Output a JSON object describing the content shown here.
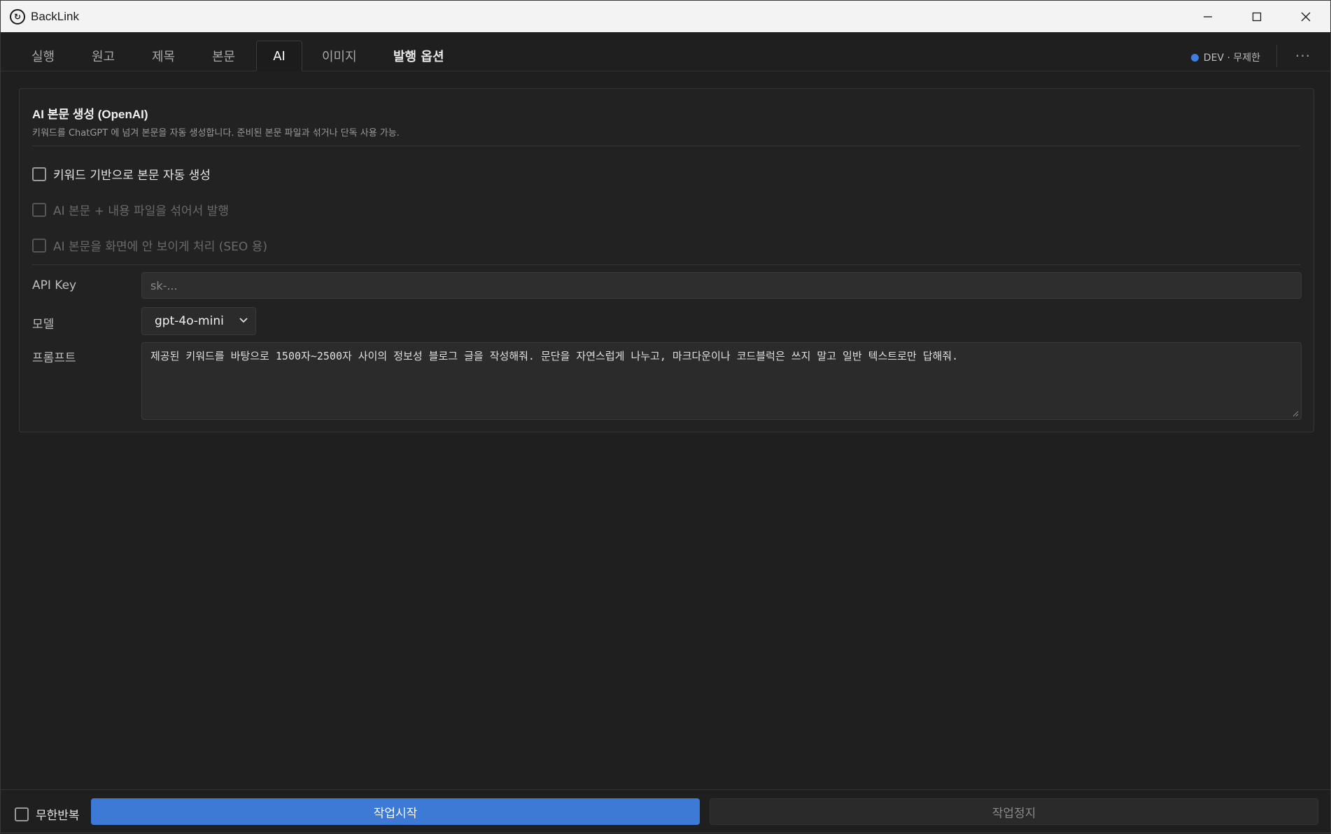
{
  "window": {
    "title": "BackLink",
    "minimize_icon": "minimize-icon",
    "maximize_icon": "maximize-icon",
    "close_icon": "close-icon"
  },
  "tabs": [
    {
      "label": "실행"
    },
    {
      "label": "원고"
    },
    {
      "label": "제목"
    },
    {
      "label": "본문"
    },
    {
      "label": "AI"
    },
    {
      "label": "이미지"
    },
    {
      "label": "발행 옵션"
    }
  ],
  "active_tab": "AI",
  "status": {
    "label": "DEV · 무제한",
    "dot_color": "#3d7ee0"
  },
  "more_label": "···",
  "panel": {
    "title": "AI 본문 생성 (OpenAI)",
    "description": "키워드를 ChatGPT 에 넘겨 본문을 자동 생성합니다. 준비된 본문 파일과 섞거나 단독 사용 가능.",
    "options": [
      {
        "label": "키워드 기반으로 본문 자동 생성",
        "checked": false,
        "disabled": false
      },
      {
        "label": "AI 본문 + 내용 파일을 섞어서 발행",
        "checked": false,
        "disabled": true
      },
      {
        "label": "AI 본문을 화면에 안 보이게 처리 (SEO 용)",
        "checked": false,
        "disabled": true
      }
    ],
    "api_key": {
      "label": "API Key",
      "placeholder": "sk-...",
      "value": ""
    },
    "model": {
      "label": "모델",
      "value": "gpt-4o-mini"
    },
    "prompt": {
      "label": "프롬프트",
      "value": "제공된 키워드를 바탕으로 1500자~2500자 사이의 정보성 블로그 글을 작성해줘. 문단을 자연스럽게 나누고, 마크다운이나 코드블럭은 쓰지 말고 일반 텍스트로만 답해줘."
    }
  },
  "bottom": {
    "loop_label": "무한반복",
    "start_label": "작업시작",
    "stop_label": "작업정지",
    "accent": "#3c7ad6"
  }
}
